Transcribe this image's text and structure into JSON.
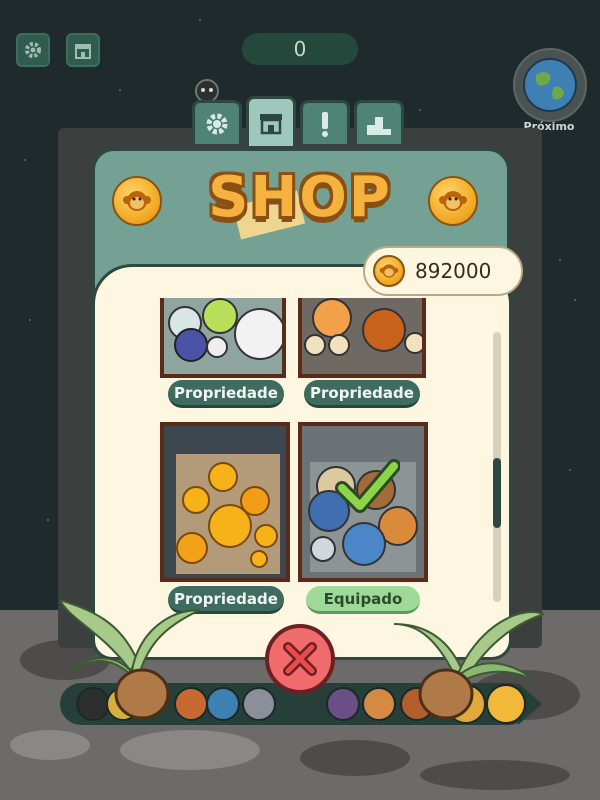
{
  "score": "0",
  "next_label": "Próximo",
  "title": "SHOP",
  "balance": "892000",
  "tabs": [
    {
      "name": "settings",
      "icon": "gear-icon"
    },
    {
      "name": "shop",
      "icon": "shop-icon"
    },
    {
      "name": "alert",
      "icon": "exclamation-icon"
    },
    {
      "name": "ranking",
      "icon": "podium-icon"
    }
  ],
  "cards": [
    {
      "theme": "sports-balls",
      "button_label": "Propriedade",
      "status": "owned"
    },
    {
      "theme": "numbered-balls",
      "button_label": "Propriedade",
      "status": "owned"
    },
    {
      "theme": "citrus-fruits",
      "button_label": "Propriedade",
      "status": "owned"
    },
    {
      "theme": "planets",
      "button_label": "Equipado",
      "status": "equipped"
    }
  ],
  "colors": {
    "accent_green": "#3f6c5f",
    "equipped_green": "#9ed99a",
    "close_red": "#f06b6b",
    "coin_gold": "#f0a51f"
  }
}
